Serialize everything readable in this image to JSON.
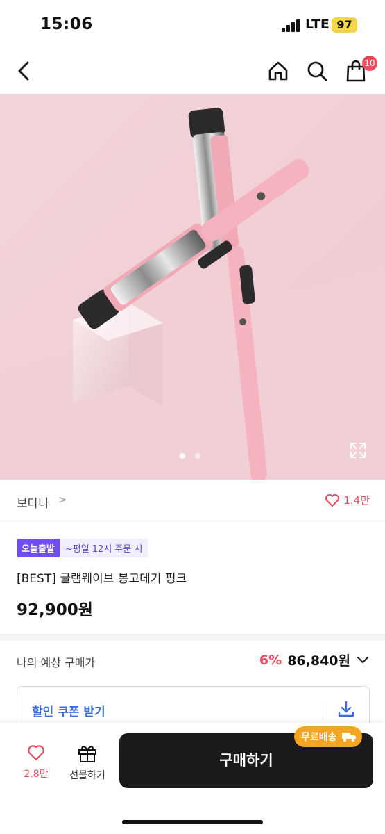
{
  "status_bar": {
    "time": "15:06",
    "network": "LTE",
    "battery": "97"
  },
  "nav": {
    "cart_count": "10"
  },
  "gallery": {
    "page_count": 2,
    "current_page": 1
  },
  "brand": {
    "name": "보다나",
    "chevron": ">",
    "like_count": "1.4만"
  },
  "product": {
    "tag_today": "오늘출발",
    "tag_time": "~평일 12시 주문 시",
    "name": "[BEST] 글램웨이브 봉고데기 핑크",
    "price": "92,900원"
  },
  "estimate": {
    "label": "나의 예상 구매가",
    "discount": "6%",
    "price": "86,840원"
  },
  "coupon": {
    "label": "할인 쿠폰 받기"
  },
  "bottom": {
    "like_count": "2.8만",
    "gift_label": "선물하기",
    "buy_label": "구매하기",
    "free_shipping": "무료배송"
  },
  "colors": {
    "accent_red": "#ef4b5f",
    "accent_purple": "#6f4cf4",
    "coupon_blue": "#3a6fd8",
    "shipping_orange": "#f5a524"
  },
  "icons": [
    "back-arrow-icon",
    "home-icon",
    "search-icon",
    "shopping-bag-icon",
    "expand-icon",
    "heart-icon",
    "chevron-down-icon",
    "download-icon",
    "gift-icon",
    "truck-icon"
  ]
}
